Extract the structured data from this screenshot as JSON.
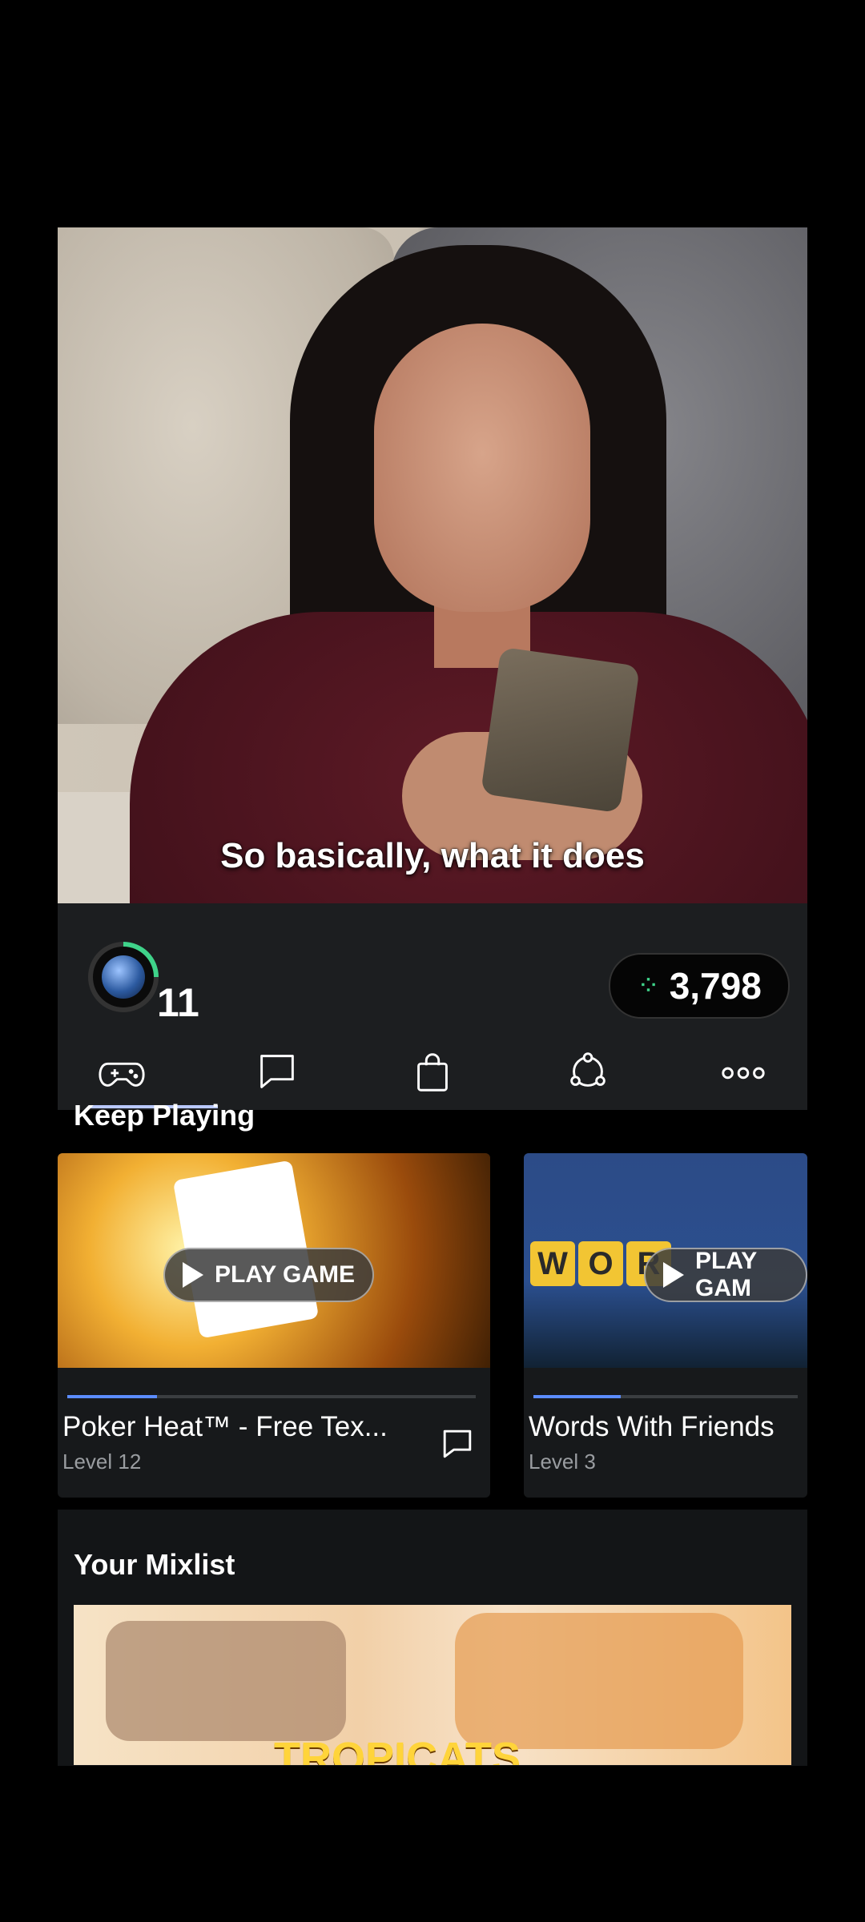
{
  "video": {
    "subtitle": "So basically, what it does"
  },
  "header": {
    "level": "11",
    "coins": "3,798",
    "coin_icon": "sparkle-icon",
    "nav": [
      {
        "icon": "gamepad-icon"
      },
      {
        "icon": "chat-icon"
      },
      {
        "icon": "shopping-bag-icon"
      },
      {
        "icon": "share-network-icon"
      },
      {
        "icon": "more-dots-icon"
      }
    ]
  },
  "keep_playing": {
    "title": "Keep Playing",
    "cards": [
      {
        "title": "Poker Heat™ - Free Tex...",
        "level": "Level 12",
        "play_label": "PLAY GAME",
        "progress": 0.22
      },
      {
        "title": "Words With Friends",
        "level": "Level 3",
        "play_label": "PLAY GAM",
        "progress": 0.33
      }
    ]
  },
  "mixlist": {
    "title": "Your Mixlist",
    "logo_text": "TROPICATS"
  },
  "colors": {
    "accent": "#3fd38a",
    "header_bg": "#1c1e20",
    "progress": "#5b8cff"
  }
}
